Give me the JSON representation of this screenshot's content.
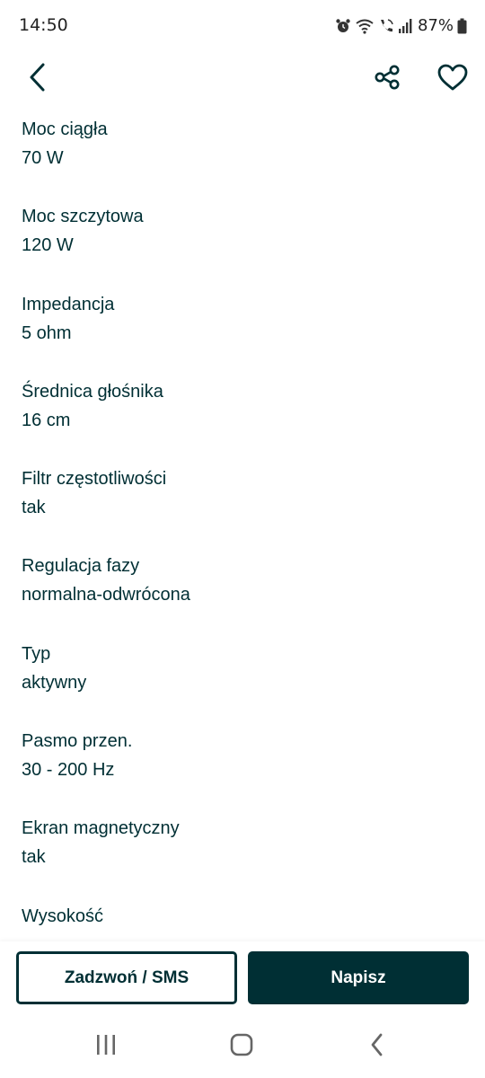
{
  "status_bar": {
    "time": "14:50",
    "battery": "87%",
    "icons": [
      "alarm-icon",
      "wifi-icon",
      "wifi-calling-icon",
      "signal-icon",
      "battery-icon"
    ]
  },
  "top_bar": {
    "icons": [
      "back-arrow-icon",
      "share-icon",
      "heart-icon"
    ]
  },
  "params": [
    {
      "label": "Moc ciągła",
      "value": "70 W"
    },
    {
      "label": "Moc szczytowa",
      "value": "120 W"
    },
    {
      "label": "Impedancja",
      "value": "5 ohm"
    },
    {
      "label": "Średnica głośnika",
      "value": "16 cm"
    },
    {
      "label": "Filtr częstotliwości",
      "value": "tak"
    },
    {
      "label": "Regulacja fazy",
      "value": "normalna-odwrócona"
    },
    {
      "label": "Typ",
      "value": "aktywny"
    },
    {
      "label": "Pasmo przen.",
      "value": "30 - 200 Hz"
    },
    {
      "label": "Ekran magnetyczny",
      "value": "tak"
    },
    {
      "label": "Wysokość",
      "value": ""
    }
  ],
  "actions": {
    "call_label": "Zadzwoń / SMS",
    "write_label": "Napisz"
  },
  "nav_bar": {
    "icons": [
      "recent-apps-icon",
      "home-icon",
      "back-icon"
    ]
  },
  "colors": {
    "primary": "#002f34",
    "background": "#ffffff"
  }
}
